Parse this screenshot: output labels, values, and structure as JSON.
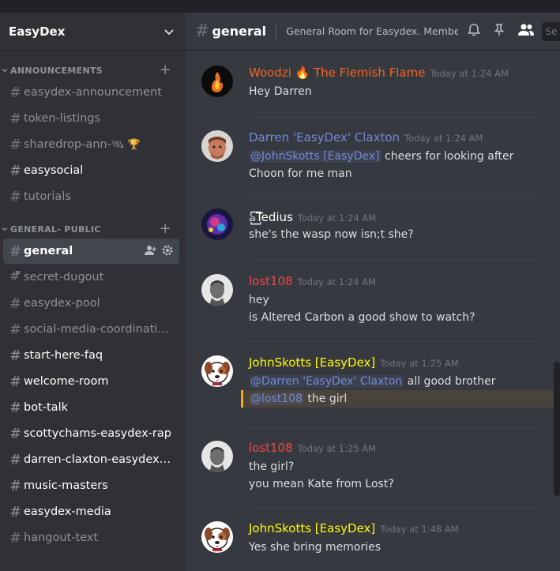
{
  "server": {
    "name": "EasyDex"
  },
  "categories": [
    {
      "name": "ANNOUNCEMENTS",
      "channels": [
        {
          "name": "easydex-announcement",
          "unread": false
        },
        {
          "name": "token-listings",
          "unread": false
        },
        {
          "name": "sharedrop-ann-",
          "unread": false,
          "emoji": "🛰 🏆"
        },
        {
          "name": "easysocial",
          "unread": true
        },
        {
          "name": "tutorials",
          "unread": false
        }
      ]
    },
    {
      "name": "GENERAL- PUBLIC",
      "channels": [
        {
          "name": "general",
          "selected": true
        },
        {
          "name": "secret-dugout",
          "locked": true
        },
        {
          "name": "easydex-pool",
          "unread": false
        },
        {
          "name": "social-media-coordination...",
          "unread": false
        },
        {
          "name": "start-here-faq",
          "unread": true
        },
        {
          "name": "welcome-room",
          "unread": true
        },
        {
          "name": "bot-talk",
          "unread": true
        },
        {
          "name": "scottychams-easydex-rap",
          "unread": true
        },
        {
          "name": "darren-claxton-easydex-st...",
          "unread": true
        },
        {
          "name": "music-masters",
          "unread": true
        },
        {
          "name": "easydex-media",
          "unread": true
        },
        {
          "name": "hangout-text",
          "unread": false
        }
      ]
    }
  ],
  "channel_header": {
    "name": "general",
    "topic": "General Room for Easydex. Members ...",
    "search_stub": "Se"
  },
  "messages": [
    {
      "author": "Woodzi 🔥 The Flemish Flame",
      "color": "#f26522",
      "time": "Today at 1:24 AM",
      "avatar": "flame",
      "lines": [
        [
          {
            "t": "Hey Darren"
          }
        ]
      ]
    },
    {
      "author": "Darren 'EasyDex' Claxton",
      "color": "#7289da",
      "time": "Today at 1:24 AM",
      "avatar": "face",
      "lines": [
        [
          {
            "t": "@JohnSkotts [EasyDex]",
            "m": true
          },
          {
            "t": " cheers for looking after"
          }
        ],
        [
          {
            "t": "Choon for me man"
          }
        ]
      ]
    },
    {
      "author": "ঌ꙱Tedius",
      "color": "#ffffff",
      "time": "Today at 1:24 AM",
      "avatar": "cosmic",
      "lines": [
        [
          {
            "t": "she's the wasp now isn;t she?"
          }
        ]
      ]
    },
    {
      "author": "lost108",
      "color": "#f04747",
      "time": "Today at 1:24 AM",
      "avatar": "bw",
      "lines": [
        [
          {
            "t": "hey"
          }
        ],
        [
          {
            "t": "is Altered Carbon a good show to watch?"
          }
        ]
      ]
    },
    {
      "author": "JohnSkotts [EasyDex]",
      "color": "#fffb00",
      "time": "Today at 1:25 AM",
      "avatar": "dog",
      "lines": [
        [
          {
            "t": "@Darren 'EasyDex' Claxton",
            "m": true
          },
          {
            "t": " all good brother"
          }
        ],
        [
          {
            "t": "@lost108",
            "m": true
          },
          {
            "t": " the girl"
          }
        ]
      ],
      "highlight_line": 1
    },
    {
      "author": "lost108",
      "color": "#f04747",
      "time": "Today at 1:25 AM",
      "avatar": "bw",
      "lines": [
        [
          {
            "t": "the girl?"
          }
        ],
        [
          {
            "t": "you mean Kate from Lost?"
          }
        ]
      ]
    },
    {
      "author": "JohnSkotts [EasyDex]",
      "color": "#fffb00",
      "time": "Today at 1:48 AM",
      "avatar": "dog",
      "lines": [
        [
          {
            "t": "Yes she bring memories"
          }
        ]
      ]
    }
  ],
  "colors": {
    "sidebar": "#2f3136",
    "main": "#36393f",
    "mention": "#7289da",
    "highlight": "#faa61a"
  },
  "icons": [
    "chevron-down-icon",
    "bell-icon",
    "pin-icon",
    "members-icon",
    "hash-icon",
    "add-member-icon",
    "gear-icon",
    "lock-icon"
  ]
}
